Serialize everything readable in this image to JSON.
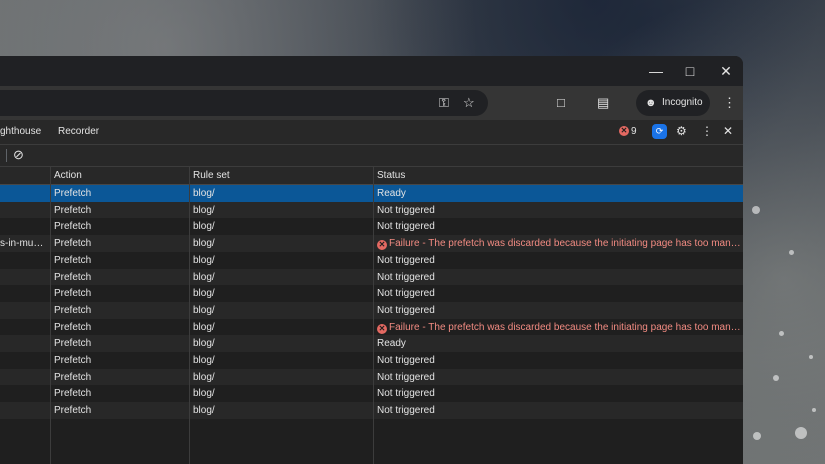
{
  "browser": {
    "incognito_label": "Incognito",
    "icons": {
      "minimize": "minimize-icon",
      "maximize": "maximize-icon",
      "close": "close-icon",
      "password_key": "key-icon",
      "bookmark_star": "star-icon",
      "extensions": "puzzle-icon",
      "tab_search": "tab-search-icon",
      "incognito": "incognito-icon",
      "menu": "more-vert-icon"
    }
  },
  "devtools": {
    "tabs": [
      "ghthouse",
      "Recorder"
    ],
    "error_count": "9",
    "clear_icon": "block-icon",
    "columns": [
      "Action",
      "Rule set",
      "Status"
    ],
    "rows": [
      {
        "url": "",
        "action": "Prefetch",
        "ruleset": "blog/",
        "status": "Ready",
        "failure": false,
        "selected": true
      },
      {
        "url": "",
        "action": "Prefetch",
        "ruleset": "blog/",
        "status": "Not triggered",
        "failure": false
      },
      {
        "url": "",
        "action": "Prefetch",
        "ruleset": "blog/",
        "status": "Not triggered",
        "failure": false
      },
      {
        "url": "s-in-mu…",
        "action": "Prefetch",
        "ruleset": "blog/",
        "status": "Failure - The prefetch was discarded because the initiating page has too man…",
        "failure": true
      },
      {
        "url": "",
        "action": "Prefetch",
        "ruleset": "blog/",
        "status": "Not triggered",
        "failure": false
      },
      {
        "url": "",
        "action": "Prefetch",
        "ruleset": "blog/",
        "status": "Not triggered",
        "failure": false
      },
      {
        "url": "",
        "action": "Prefetch",
        "ruleset": "blog/",
        "status": "Not triggered",
        "failure": false
      },
      {
        "url": "",
        "action": "Prefetch",
        "ruleset": "blog/",
        "status": "Not triggered",
        "failure": false
      },
      {
        "url": "",
        "action": "Prefetch",
        "ruleset": "blog/",
        "status": "Failure - The prefetch was discarded because the initiating page has too man…",
        "failure": true
      },
      {
        "url": "",
        "action": "Prefetch",
        "ruleset": "blog/",
        "status": "Ready",
        "failure": false
      },
      {
        "url": "",
        "action": "Prefetch",
        "ruleset": "blog/",
        "status": "Not triggered",
        "failure": false
      },
      {
        "url": "",
        "action": "Prefetch",
        "ruleset": "blog/",
        "status": "Not triggered",
        "failure": false
      },
      {
        "url": "",
        "action": "Prefetch",
        "ruleset": "blog/",
        "status": "Not triggered",
        "failure": false
      },
      {
        "url": "",
        "action": "Prefetch",
        "ruleset": "blog/",
        "status": "Not triggered",
        "failure": false
      }
    ]
  },
  "colors": {
    "selected_row": "#0b5797",
    "failure_text": "#f28b82",
    "accent_blue": "#1a73e8"
  }
}
